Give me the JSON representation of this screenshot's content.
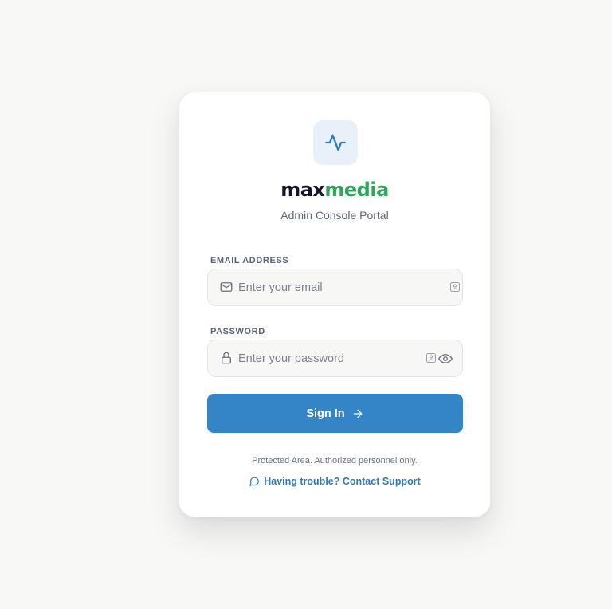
{
  "brand": {
    "part1": "max",
    "part2": "media",
    "subtitle": "Admin Console Portal"
  },
  "logo": {
    "icon": "activity-pulse-icon"
  },
  "email": {
    "label": "EMAIL ADDRESS",
    "placeholder": "Enter your email",
    "value": ""
  },
  "password": {
    "label": "PASSWORD",
    "placeholder": "Enter your password",
    "value": ""
  },
  "signin": {
    "label": "Sign In"
  },
  "footer": {
    "notice": "Protected Area. Authorized personnel only.",
    "support_label": "Having trouble? Contact Support"
  },
  "colors": {
    "accent": "#3385c8",
    "brand_dark": "#15162a",
    "brand_green": "#2ea55a",
    "link": "#2f7bb8"
  }
}
